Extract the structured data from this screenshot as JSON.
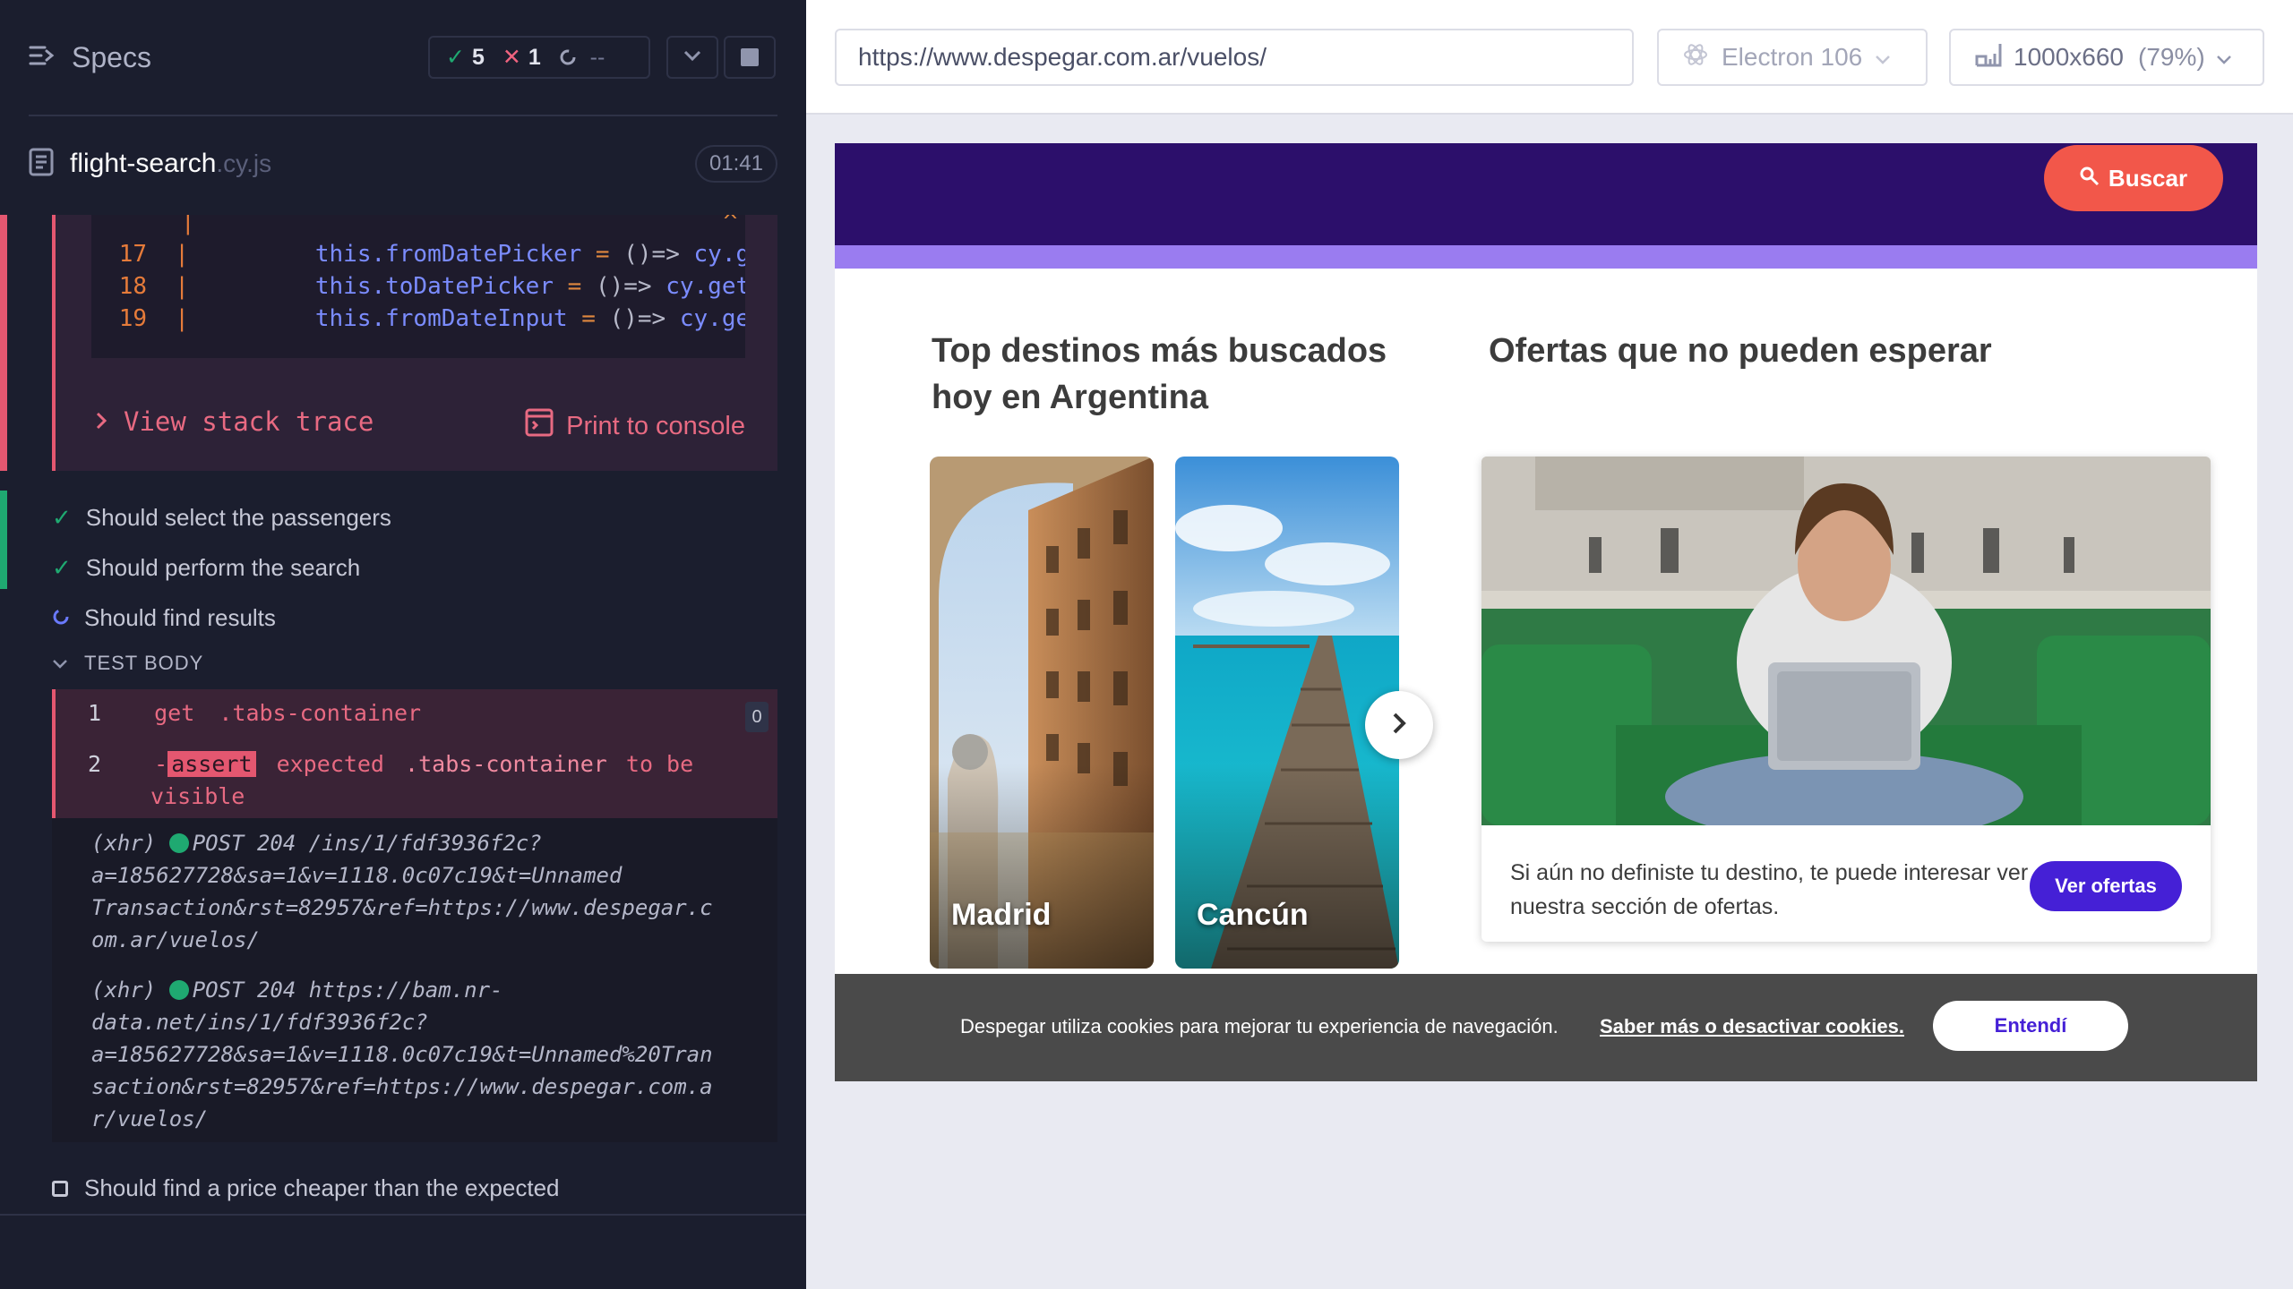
{
  "reporter": {
    "title": "Specs",
    "stats": {
      "passed": "5",
      "failed": "1",
      "pending": "--"
    },
    "file": {
      "name": "flight-search",
      "ext": ".cy.js",
      "duration": "01:41"
    },
    "code": {
      "caret": "^",
      "lines": [
        {
          "num": "17",
          "pre": "         ",
          "name": "this.fromDatePicker",
          "eq": " = ",
          "arrow": "()=>",
          "rest": " cy.g"
        },
        {
          "num": "18",
          "pre": "         ",
          "name": "this.toDatePicker",
          "eq": " = ",
          "arrow": "()=>",
          "rest": " cy.get"
        },
        {
          "num": "19",
          "pre": "         ",
          "name": "this.fromDateInput",
          "eq": " = ",
          "arrow": "()=>",
          "rest": " cy.ge"
        }
      ]
    },
    "view_stack_trace": "View stack trace",
    "print_to_console": "Print to console",
    "tests": [
      "Should select the passengers",
      "Should perform the search",
      "Should find results",
      "Should find a price cheaper than the expected"
    ],
    "test_body_label": "TEST BODY",
    "commands": {
      "c1": {
        "num": "1",
        "name": "get",
        "selector": ".tabs-container",
        "badge": "0"
      },
      "c2": {
        "num": "2",
        "prefix": "-",
        "name": "assert",
        "word1": "expected",
        "selector": ".tabs-container",
        "word2": "to be",
        "word3": "visible"
      }
    },
    "xhr": [
      {
        "tag": "(xhr)",
        "status": "POST 204 /ins/1/fdf3936f2c?",
        "lines": [
          "a=185627728&sa=1&v=1118.0c07c19&t=Unnamed",
          "Transaction&rst=82957&ref=https://www.despegar.c",
          "om.ar/vuelos/"
        ]
      },
      {
        "tag": "(xhr)",
        "status": "POST 204 https://bam.nr-",
        "lines": [
          "data.net/ins/1/fdf3936f2c?",
          "a=185627728&sa=1&v=1118.0c07c19&t=Unnamed%20Tran",
          "saction&rst=82957&ref=https://www.despegar.com.a",
          "r/vuelos/"
        ]
      }
    ]
  },
  "preview": {
    "url": "https://www.despegar.com.ar/vuelos/",
    "browser": "Electron 106",
    "viewport": "1000x660",
    "scale": "(79%)",
    "page": {
      "buscar": "Buscar",
      "top_title": [
        "Top destinos más buscados",
        "hoy en Argentina"
      ],
      "offers_title": "Ofertas que no pueden esperar",
      "destinations": [
        "Madrid",
        "Cancún"
      ],
      "offer_text": "Si aún no definiste tu destino, te puede interesar ver nuestra sección de ofertas.",
      "ver_ofertas": "Ver ofertas",
      "cookie_text": "Despegar utiliza cookies para mejorar tu experiencia de navegación.",
      "cookie_link": "Saber más o desactivar cookies.",
      "cookie_button": "Entendí"
    }
  },
  "colors": {
    "brand_purple": "#2c0f6b",
    "buscar_red": "#f2574a",
    "cta_blue": "#4520d6",
    "fail_red": "#e45770",
    "pass_green": "#1fa971"
  },
  "icons": [
    "specs-icon",
    "check-icon",
    "cross-icon",
    "spinner-icon",
    "chevron-down-icon",
    "stop-icon",
    "file-icon",
    "chevron-right-icon",
    "console-icon",
    "browser-icon",
    "viewport-icon",
    "search-icon",
    "next-arrow-icon"
  ]
}
